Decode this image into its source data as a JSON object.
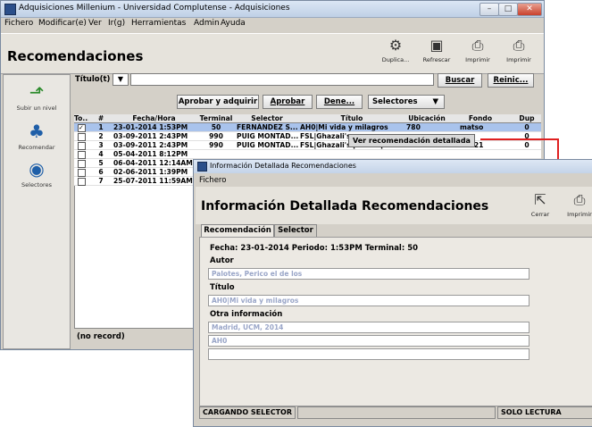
{
  "main_window": {
    "title": "Adquisiciones Millenium - Universidad Complutense - Adquisiciones",
    "menu": [
      "Fichero",
      "Modificar(e)",
      "Ver",
      "Ir(g)",
      "Herramientas",
      "Admin",
      "Ayuda"
    ],
    "heading": "Recomendaciones",
    "toolbar": {
      "duplicate_label": "Duplica...",
      "refresh_label": "Refrescar",
      "print1_label": "Imprimir",
      "print2_label": "Imprimir"
    },
    "left_panel": {
      "up_label": "Subir un nivel",
      "recommend_label": "Recomendar",
      "selectors_label": "Selectores"
    },
    "search": {
      "field_label": "Título(t)",
      "value": "",
      "search_button": "Buscar",
      "reset_button": "Reinic..."
    },
    "actions": {
      "approve_acquire": "Aprobar y adquirir",
      "approve": "Aprobar",
      "deny": "Dene...",
      "selectors": "Selectores"
    },
    "table": {
      "columns": [
        "To...",
        "#",
        "Fecha/Hora",
        "Terminal",
        "Selector",
        "Título",
        "Ubicación",
        "Fondo",
        "Dup"
      ],
      "rows": [
        {
          "checked": true,
          "n": "1",
          "fecha": "23-01-2014 1:53PM",
          "terminal": "50",
          "selector": "FERNÁNDEZ S...",
          "titulo": "AH0|Mi vida y milagros",
          "ubicacion": "780",
          "fondo": "matso",
          "dup": "0"
        },
        {
          "checked": false,
          "n": "2",
          "fecha": "03-09-2011 2:43PM",
          "terminal": "990",
          "selector": "PUIG MONTAD...",
          "titulo": "FSL|Ghazali's",
          "ubicacion": "",
          "fondo": "",
          "dup": "0"
        },
        {
          "checked": false,
          "n": "3",
          "fecha": "03-09-2011 2:43PM",
          "terminal": "990",
          "selector": "PUIG MONTAD...",
          "titulo": "FSL|Ghazali's philosophic...",
          "ubicacion": "300",
          "fondo": "30021",
          "dup": "0"
        },
        {
          "checked": false,
          "n": "4",
          "fecha": "05-04-2011 8:12PM",
          "terminal": "",
          "selector": "",
          "titulo": "",
          "ubicacion": "",
          "fondo": "",
          "dup": ""
        },
        {
          "checked": false,
          "n": "5",
          "fecha": "06-04-2011 12:14AM",
          "terminal": "",
          "selector": "",
          "titulo": "",
          "ubicacion": "",
          "fondo": "",
          "dup": ""
        },
        {
          "checked": false,
          "n": "6",
          "fecha": "02-06-2011 1:39PM",
          "terminal": "",
          "selector": "",
          "titulo": "",
          "ubicacion": "",
          "fondo": "",
          "dup": ""
        },
        {
          "checked": false,
          "n": "7",
          "fecha": "25-07-2011 11:59AM",
          "terminal": "",
          "selector": "",
          "titulo": "",
          "ubicacion": "",
          "fondo": "",
          "dup": ""
        }
      ]
    },
    "context_tooltip": "Ver recomendación detallada",
    "status": "(no record)"
  },
  "detail_window": {
    "title": "Información Detallada Recomendaciones",
    "menu": [
      "Fichero"
    ],
    "heading": "Información Detallada Recomendaciones",
    "close_label": "Cerrar",
    "print_label": "Imprimir",
    "tabs": [
      "Recomendación",
      "Selector"
    ],
    "info_line": "Fecha: 23-01-2014   Periodo: 1:53PM   Terminal: 50",
    "autor_label": "Autor",
    "autor_value": "Palotes, Perico el de los",
    "titulo_label": "Título",
    "titulo_value": "AH0|Mi vida y milagros",
    "otra_label": "Otra información",
    "otra_values": [
      "Madrid, UCM, 2014",
      "AH0",
      ""
    ],
    "status_left": "CARGANDO SELECTOR",
    "status_right": "SOLO LECTURA"
  },
  "colors": {
    "selection": "#a9c3ec",
    "annotation_line": "#e02020",
    "field_text": "#9aa6c8"
  }
}
